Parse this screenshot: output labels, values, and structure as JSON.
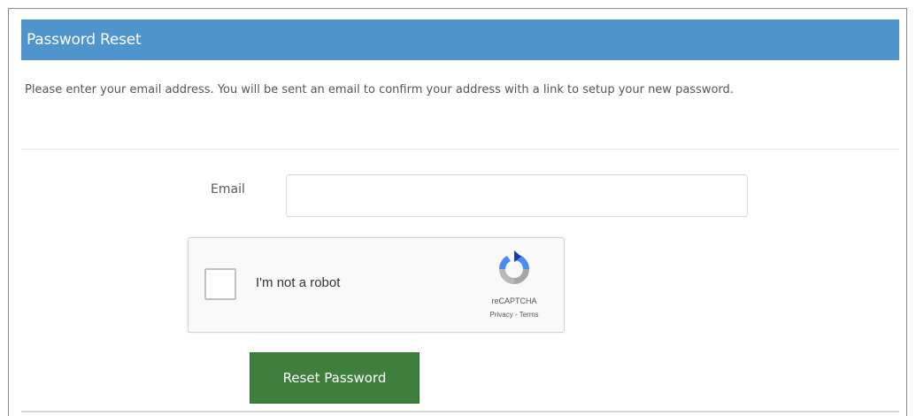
{
  "header": {
    "title": "Password Reset",
    "color": "#4f94cc"
  },
  "instructions": {
    "text": "Please enter your email address. You will be sent an email to confirm your address with a link to setup your new password."
  },
  "form": {
    "email_label": "Email",
    "email_value": "",
    "email_placeholder": ""
  },
  "captcha": {
    "label": "I'm not a robot",
    "brand": "reCAPTCHA",
    "privacy": "Privacy",
    "separator": " - ",
    "terms": "Terms",
    "icon": "recaptcha-logo-icon"
  },
  "actions": {
    "reset_label": "Reset Password",
    "reset_color": "#3f7f3d"
  }
}
